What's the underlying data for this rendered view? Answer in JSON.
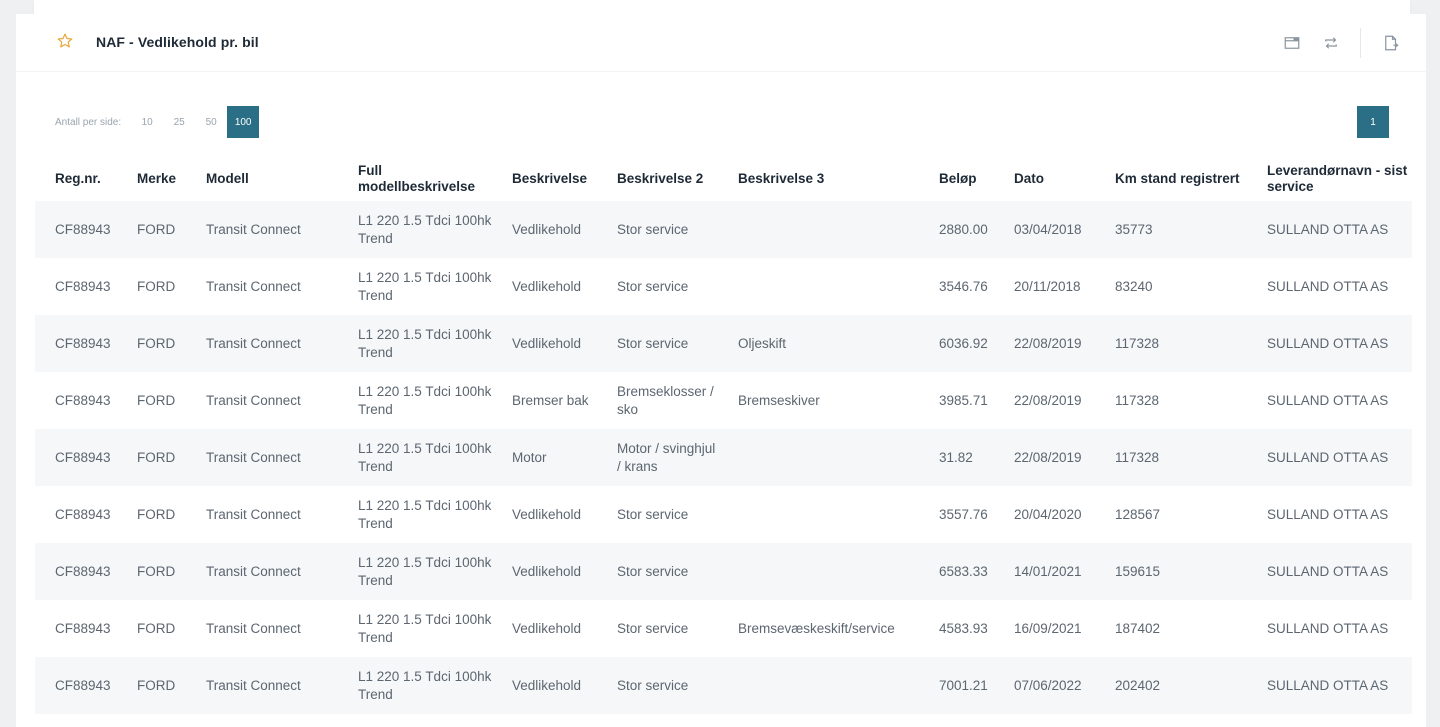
{
  "panel": {
    "title": "NAF - Vedlikehold pr. bil",
    "icons": [
      "star-icon",
      "window-icon",
      "refresh-icon",
      "export-icon"
    ]
  },
  "pagination": {
    "label": "Antall per side:",
    "options": [
      "10",
      "25",
      "50",
      "100"
    ],
    "selected": "100",
    "current_page": "1"
  },
  "table": {
    "columns": [
      "Reg.nr.",
      "Merke",
      "Modell",
      "Full modellbeskrivelse",
      "Beskrivelse",
      "Beskrivelse 2",
      "Beskrivelse 3",
      "Beløp",
      "Dato",
      "Km stand registrert",
      "Leverandørnavn - sist service"
    ],
    "rows": [
      [
        "CF88943",
        "FORD",
        "Transit Connect",
        "L1 220 1.5 Tdci 100hk Trend",
        "Vedlikehold",
        "Stor service",
        "",
        "2880.00",
        "03/04/2018",
        "35773",
        "SULLAND OTTA AS"
      ],
      [
        "CF88943",
        "FORD",
        "Transit Connect",
        "L1 220 1.5 Tdci 100hk Trend",
        "Vedlikehold",
        "Stor service",
        "",
        "3546.76",
        "20/11/2018",
        "83240",
        "SULLAND OTTA AS"
      ],
      [
        "CF88943",
        "FORD",
        "Transit Connect",
        "L1 220 1.5 Tdci 100hk Trend",
        "Vedlikehold",
        "Stor service",
        "Oljeskift",
        "6036.92",
        "22/08/2019",
        "117328",
        "SULLAND OTTA AS"
      ],
      [
        "CF88943",
        "FORD",
        "Transit Connect",
        "L1 220 1.5 Tdci 100hk Trend",
        "Bremser bak",
        "Bremseklosser / sko",
        "Bremseskiver",
        "3985.71",
        "22/08/2019",
        "117328",
        "SULLAND OTTA AS"
      ],
      [
        "CF88943",
        "FORD",
        "Transit Connect",
        "L1 220 1.5 Tdci 100hk Trend",
        "Motor",
        "Motor / svinghjul / krans",
        "",
        "31.82",
        "22/08/2019",
        "117328",
        "SULLAND OTTA AS"
      ],
      [
        "CF88943",
        "FORD",
        "Transit Connect",
        "L1 220 1.5 Tdci 100hk Trend",
        "Vedlikehold",
        "Stor service",
        "",
        "3557.76",
        "20/04/2020",
        "128567",
        "SULLAND OTTA AS"
      ],
      [
        "CF88943",
        "FORD",
        "Transit Connect",
        "L1 220 1.5 Tdci 100hk Trend",
        "Vedlikehold",
        "Stor service",
        "",
        "6583.33",
        "14/01/2021",
        "159615",
        "SULLAND OTTA AS"
      ],
      [
        "CF88943",
        "FORD",
        "Transit Connect",
        "L1 220 1.5 Tdci 100hk Trend",
        "Vedlikehold",
        "Stor service",
        "Bremsevæskeskift/service",
        "4583.93",
        "16/09/2021",
        "187402",
        "SULLAND OTTA AS"
      ],
      [
        "CF88943",
        "FORD",
        "Transit Connect",
        "L1 220 1.5 Tdci 100hk Trend",
        "Vedlikehold",
        "Stor service",
        "",
        "7001.21",
        "07/06/2022",
        "202402",
        "SULLAND OTTA AS"
      ]
    ]
  },
  "colors": {
    "accent": "#2a6f86",
    "star": "#e9a93a"
  }
}
